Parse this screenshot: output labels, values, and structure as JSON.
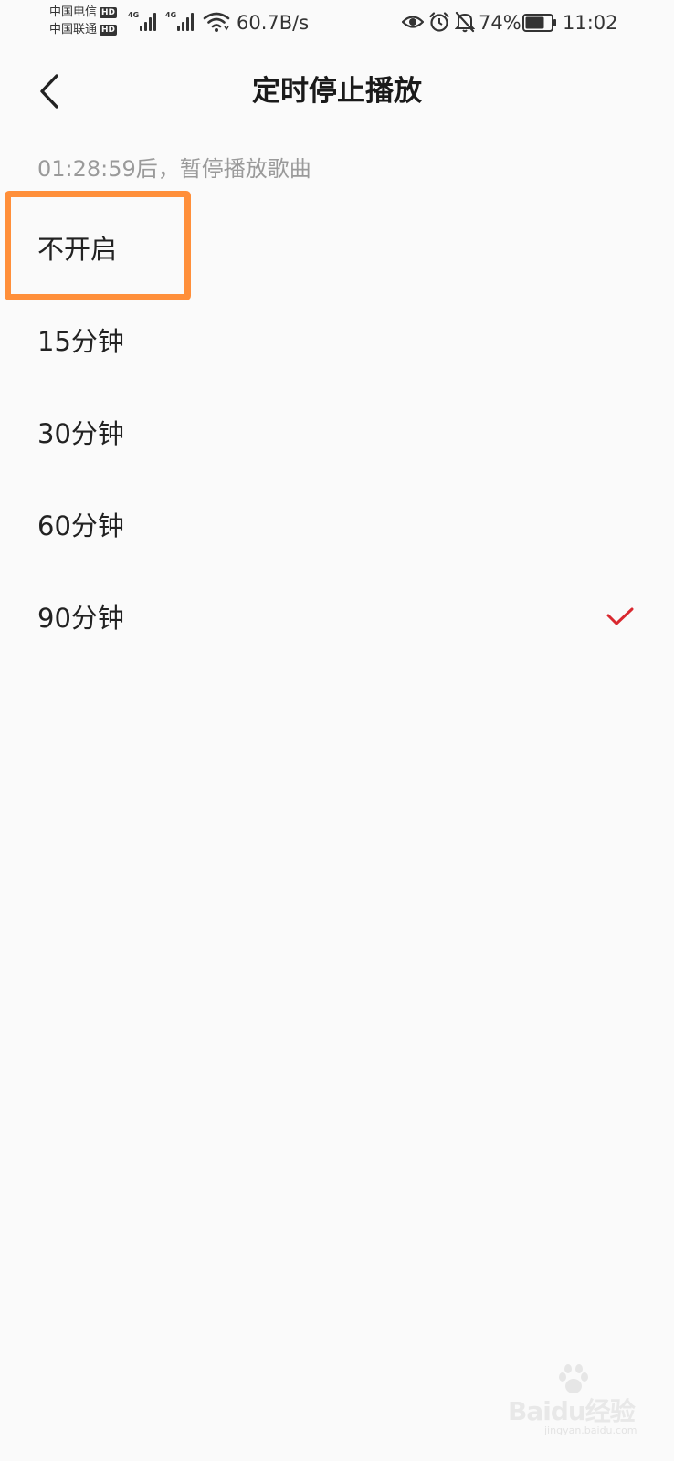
{
  "status_bar": {
    "carrier1": "中国电信",
    "carrier2": "中国联通",
    "hd_badge": "HD",
    "signal_tag": "4G",
    "net_speed": "60.7B/s",
    "battery_percent": "74%",
    "battery_level": 0.74,
    "time": "11:02"
  },
  "header": {
    "title": "定时停止播放"
  },
  "countdown": "01:28:59后，暂停播放歌曲",
  "options": [
    {
      "label": "不开启",
      "selected": false
    },
    {
      "label": "15分钟",
      "selected": false
    },
    {
      "label": "30分钟",
      "selected": false
    },
    {
      "label": "60分钟",
      "selected": false
    },
    {
      "label": "90分钟",
      "selected": true
    }
  ],
  "watermark": {
    "main": "Baidu经验",
    "sub": "jingyan.baidu.com"
  },
  "colors": {
    "accent_check": "#d9282f",
    "highlight_box": "#ff8f3a",
    "background": "#fafafa",
    "secondary_text": "#9a9a9a"
  },
  "icons": [
    "back-arrow-icon",
    "wifi-icon",
    "eye-icon",
    "alarm-icon",
    "bell-off-icon",
    "battery-icon",
    "check-icon"
  ]
}
